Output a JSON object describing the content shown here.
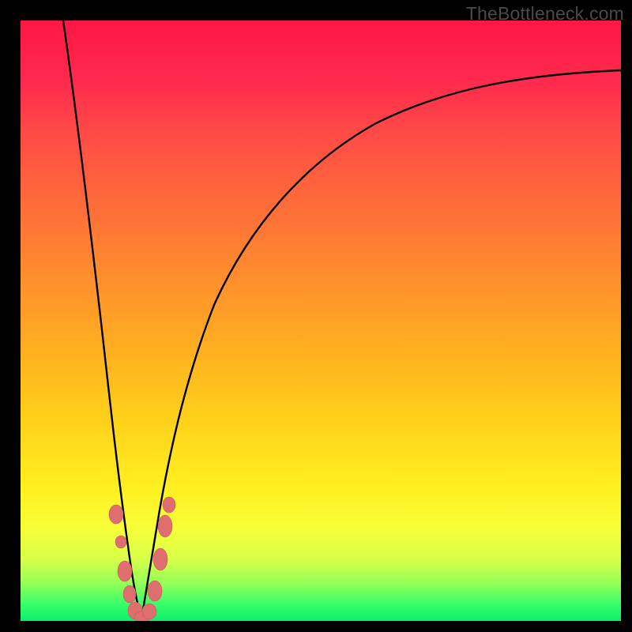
{
  "watermark": "TheBottleneck.com",
  "chart_data": {
    "type": "line",
    "title": "",
    "xlabel": "",
    "ylabel": "",
    "xlim": [
      0,
      100
    ],
    "ylim": [
      0,
      100
    ],
    "background_gradient": [
      "#ff1744",
      "#ff8c2e",
      "#fff020",
      "#0cf06a"
    ],
    "series": [
      {
        "name": "bottleneck-curve-left",
        "x": [
          5,
          6,
          7,
          8,
          9,
          10,
          11,
          12,
          13,
          14,
          15,
          16,
          17,
          18
        ],
        "values": [
          100,
          88,
          76,
          65,
          55,
          46,
          37,
          29,
          22,
          16,
          10,
          6,
          2,
          0
        ]
      },
      {
        "name": "bottleneck-curve-right",
        "x": [
          18,
          19,
          20,
          22,
          24,
          27,
          30,
          34,
          40,
          48,
          58,
          70,
          84,
          100
        ],
        "values": [
          0,
          5,
          10,
          20,
          30,
          40,
          50,
          58,
          66,
          73,
          79,
          83,
          86,
          88
        ]
      }
    ],
    "markers": {
      "name": "data-points",
      "color": "#e06d6d",
      "points": [
        {
          "x": 14.7,
          "y": 16
        },
        {
          "x": 15.2,
          "y": 12
        },
        {
          "x": 15.8,
          "y": 7
        },
        {
          "x": 16.4,
          "y": 4
        },
        {
          "x": 17.0,
          "y": 2
        },
        {
          "x": 17.6,
          "y": 1
        },
        {
          "x": 18.2,
          "y": 0.6
        },
        {
          "x": 18.8,
          "y": 2
        },
        {
          "x": 19.6,
          "y": 5
        },
        {
          "x": 20.2,
          "y": 10
        },
        {
          "x": 20.8,
          "y": 14
        },
        {
          "x": 21.4,
          "y": 18
        }
      ]
    }
  }
}
